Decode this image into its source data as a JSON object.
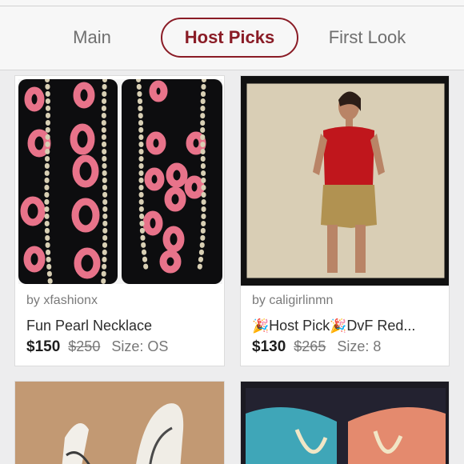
{
  "tabs": {
    "main": "Main",
    "host_picks": "Host Picks",
    "first_look": "First Look"
  },
  "accent_color": "#8a1c26",
  "listings": [
    {
      "seller": "by xfashionx",
      "title": "Fun Pearl Necklace",
      "price": "$150",
      "original_price": "$250",
      "size": "Size: OS"
    },
    {
      "seller": "by caligirlinmn",
      "title_prefix": "🎉",
      "title_host": "Host Pick",
      "title_mid": "🎉",
      "title_rest": "DvF Red...",
      "price": "$130",
      "original_price": "$265",
      "size": "Size: 8"
    }
  ]
}
